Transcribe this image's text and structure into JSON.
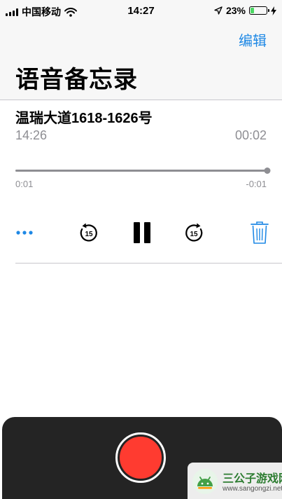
{
  "status_bar": {
    "carrier": "中国移动",
    "time": "14:27",
    "battery": "23%",
    "battery_level": 0.23
  },
  "header": {
    "edit_label": "编辑",
    "title": "语音备忘录"
  },
  "recording": {
    "title": "温瑞大道1618-1626号",
    "date": "14:26",
    "duration": "00:02",
    "elapsed": "0:01",
    "remaining": "-0:01",
    "progress": 1.0
  },
  "controls": {
    "more_icon": "more-dots-icon",
    "rewind_icon": "rewind-15-icon",
    "rewind_seconds": "15",
    "pause_icon": "pause-icon",
    "forward_icon": "forward-15-icon",
    "forward_seconds": "15",
    "trash_icon": "trash-icon"
  },
  "watermark": {
    "name": "三公子游戏网",
    "url": "www.sangongzi.net"
  },
  "colors": {
    "accent": "#1e88e5",
    "record": "#ff3b30",
    "panel": "#242424",
    "secondary_text": "#8e8e93"
  }
}
